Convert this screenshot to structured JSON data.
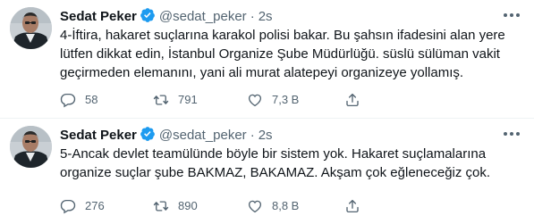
{
  "tweets": [
    {
      "author_name": "Sedat Peker",
      "handle": "@sedat_peker",
      "separator": "·",
      "time": "2s",
      "text_lines": [
        "4-İftira, hakaret suçlarına karakol polisi bakar. Bu şahsın ifadesini alan yere",
        "lütfen dikkat edin, İstanbul Organize Şube Müdürlüğü. süslü sülüman vakit",
        "geçirmeden elemanını, yani ali murat alatepeyi organizeye yollamış."
      ],
      "replies": "58",
      "retweets": "791",
      "likes": "7,3 B"
    },
    {
      "author_name": "Sedat Peker",
      "handle": "@sedat_peker",
      "separator": "·",
      "time": "2s",
      "text_lines": [
        "5-Ancak devlet teamülünde böyle bir sistem yok. Hakaret suçlamalarına",
        "organize suçlar şube BAKMAZ, BAKAMAZ. Akşam çok eğleneceğiz çok."
      ],
      "replies": "276",
      "retweets": "890",
      "likes": "8,8 B"
    }
  ],
  "icons": {
    "verified": "verified-badge-icon",
    "more": "more-horizontal-icon",
    "reply": "reply-icon",
    "retweet": "retweet-icon",
    "like": "heart-icon",
    "share": "share-icon"
  },
  "colors": {
    "verified": "#1d9bf0",
    "text_primary": "#0f1419",
    "text_secondary": "#536471",
    "divider": "#eff3f4"
  }
}
